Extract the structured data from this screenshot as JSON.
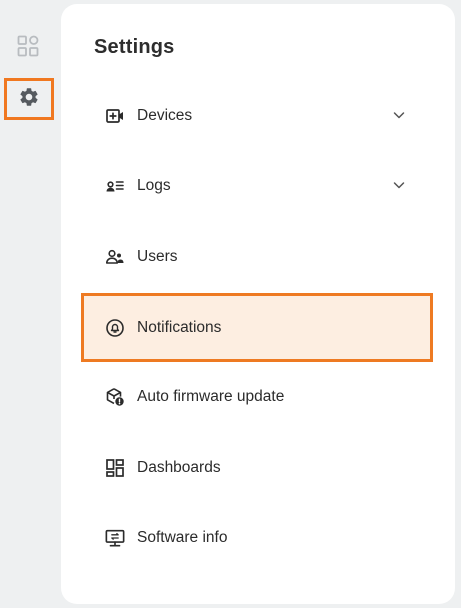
{
  "rail": {
    "items": [
      {
        "icon": "apps-grid-icon",
        "active": false
      },
      {
        "icon": "gear-icon",
        "active": true
      }
    ]
  },
  "settings": {
    "title": "Settings",
    "items": [
      {
        "label": "Devices",
        "icon": "add-device-icon",
        "expandable": true
      },
      {
        "label": "Logs",
        "icon": "logs-icon",
        "expandable": true
      },
      {
        "label": "Users",
        "icon": "users-icon",
        "expandable": false
      },
      {
        "label": "Notifications",
        "icon": "bell-icon",
        "expandable": false,
        "active": true
      },
      {
        "label": "Auto firmware update",
        "icon": "firmware-update-icon",
        "expandable": false
      },
      {
        "label": "Dashboards",
        "icon": "dashboards-icon",
        "expandable": false
      },
      {
        "label": "Software info",
        "icon": "monitor-icon",
        "expandable": false
      }
    ]
  },
  "colors": {
    "accent": "#ee7a22",
    "active_bg": "#fdeee1",
    "rail_bg": "#eef0f1",
    "icon_inactive": "#b8bcc0",
    "icon_active": "#555a5f"
  }
}
